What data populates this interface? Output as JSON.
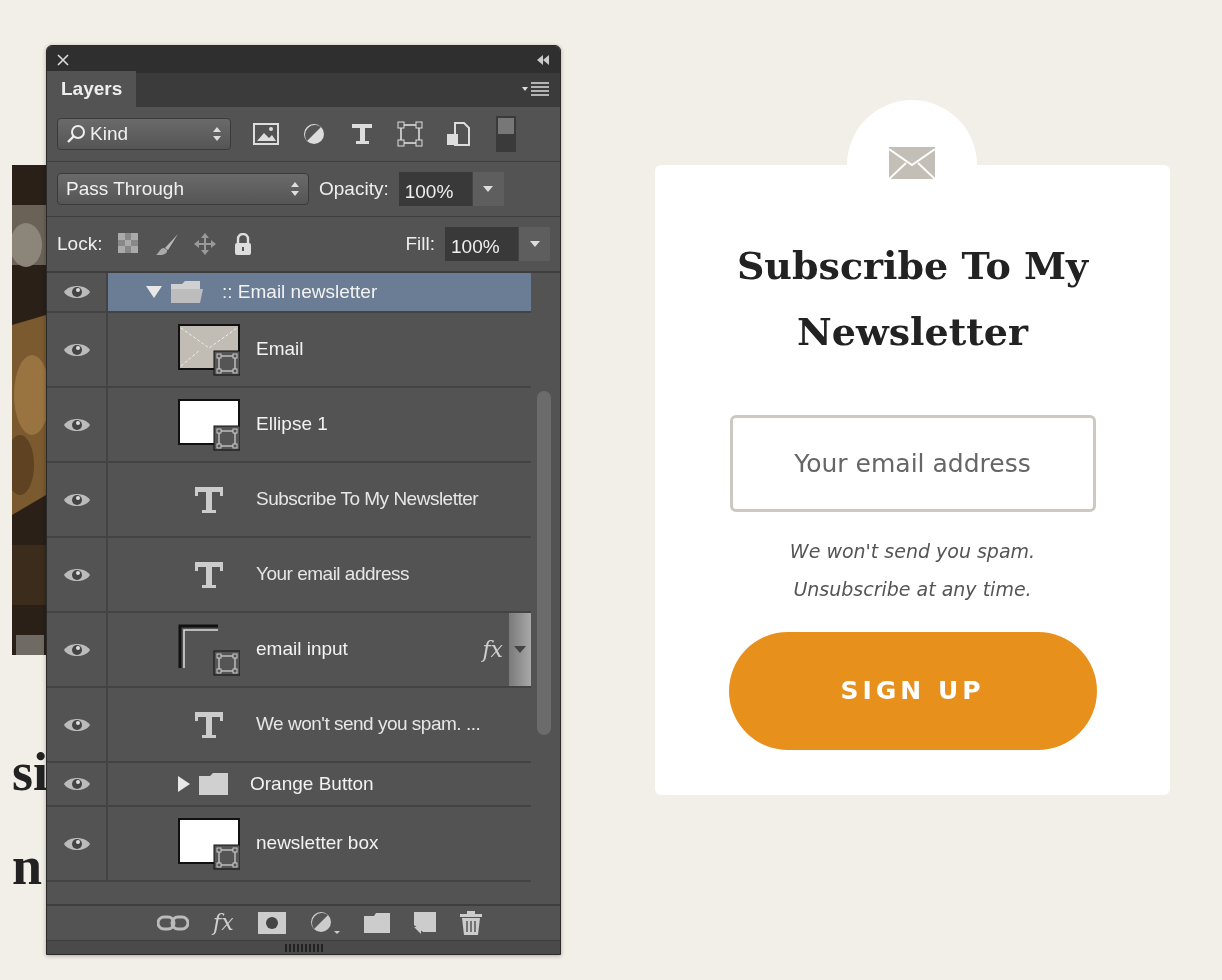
{
  "background": {
    "heading_fragments": [
      "si",
      "n"
    ]
  },
  "layers_panel": {
    "title": "Layers",
    "filter": {
      "value": "Kind",
      "icons": [
        {
          "kind": "pixel"
        },
        {
          "kind": "adjustment"
        },
        {
          "kind": "type"
        },
        {
          "kind": "shape"
        },
        {
          "kind": "smart"
        },
        {
          "kind": "toggle",
          "on": true
        }
      ]
    },
    "blend_mode": "Pass Through",
    "opacity_label": "Opacity:",
    "opacity": "100%",
    "lock_label": "Lock:",
    "locks": [
      {
        "kind": "pixels"
      },
      {
        "kind": "paint"
      },
      {
        "kind": "move"
      },
      {
        "kind": "all"
      }
    ],
    "fill_label": "Fill:",
    "fill": "100%",
    "layers": [
      {
        "kind": "group",
        "name": ":: Email newsletter",
        "visible": true,
        "selected": true,
        "expanded": true,
        "children": [
          {
            "kind": "envelope",
            "name": "Email",
            "visible": true,
            "selected": false
          },
          {
            "kind": "shape",
            "name": "Ellipse 1",
            "visible": true,
            "selected": false
          },
          {
            "kind": "text",
            "name": "Subscribe To My Newsletter",
            "visible": true,
            "selected": false
          },
          {
            "kind": "text",
            "name": "Your email address",
            "visible": true,
            "selected": false
          },
          {
            "kind": "outline",
            "name": "email input",
            "visible": true,
            "selected": false,
            "effects": "fx"
          },
          {
            "kind": "text",
            "name": "We won't send you spam. ...",
            "visible": true,
            "selected": false
          },
          {
            "kind": "group",
            "name": "Orange Button",
            "visible": true,
            "selected": false,
            "expanded": false
          },
          {
            "kind": "shape",
            "name": "newsletter box",
            "visible": true,
            "selected": false
          }
        ]
      }
    ],
    "footer": [
      {
        "kind": "link"
      },
      {
        "kind": "effects",
        "label": "fx"
      },
      {
        "kind": "mask"
      },
      {
        "kind": "adjustment"
      },
      {
        "kind": "group"
      },
      {
        "kind": "new"
      },
      {
        "kind": "delete"
      }
    ]
  },
  "newsletter_card": {
    "title": "Subscribe To My Newsletter",
    "email_field": {
      "placeholder": "Your email address"
    },
    "note": "We won't send you spam. Unsubscribe at any time.",
    "button": "SIGN UP"
  }
}
